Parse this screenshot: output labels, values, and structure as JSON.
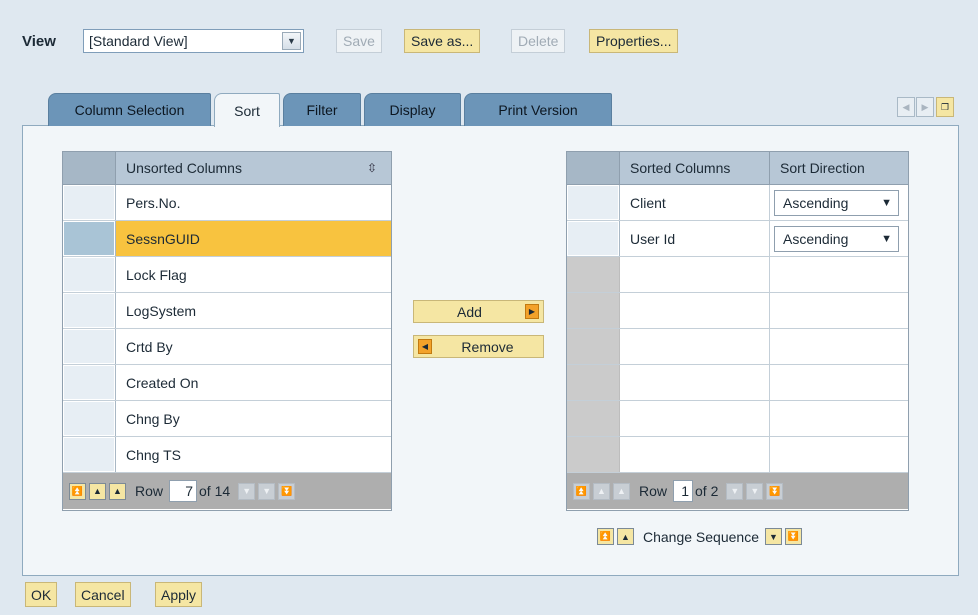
{
  "toolbar": {
    "view_label": "View",
    "view_value": "[Standard View]",
    "save": "Save",
    "save_as": "Save as...",
    "delete": "Delete",
    "properties": "Properties..."
  },
  "tabs": [
    {
      "label": "Column Selection",
      "active": false
    },
    {
      "label": "Sort",
      "active": true
    },
    {
      "label": "Filter",
      "active": false
    },
    {
      "label": "Display",
      "active": false
    },
    {
      "label": "Print Version",
      "active": false
    }
  ],
  "unsorted": {
    "header": "Unsorted Columns",
    "rows": [
      "Pers.No.",
      "SessnGUID",
      "Lock Flag",
      "LogSystem",
      "Crtd By",
      "Created On",
      "Chng By",
      "Chng TS"
    ],
    "selected_index": 1,
    "row_label": "Row",
    "row_value": "7",
    "row_total": "of 14"
  },
  "move": {
    "add": "Add",
    "remove": "Remove"
  },
  "sorted": {
    "header_col": "Sorted Columns",
    "header_dir": "Sort Direction",
    "rows": [
      {
        "column": "Client",
        "direction": "Ascending"
      },
      {
        "column": "User Id",
        "direction": "Ascending"
      }
    ],
    "row_label": "Row",
    "row_value": "1",
    "row_total": "of 2",
    "change_sequence": "Change Sequence"
  },
  "bottom": {
    "ok": "OK",
    "cancel": "Cancel",
    "apply": "Apply"
  },
  "colors": {
    "accent_yellow": "#f5e6a3",
    "selected_row": "#f8c33f",
    "tab_blue": "#6c95b8"
  }
}
